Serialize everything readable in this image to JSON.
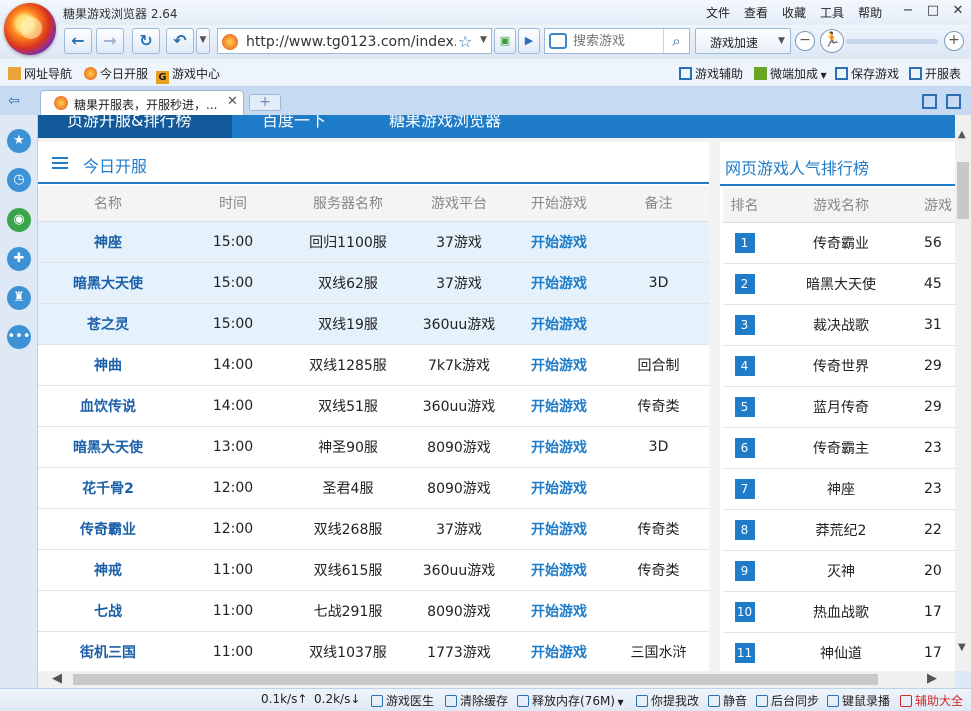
{
  "app": {
    "title": "糖果游戏浏览器 2.64",
    "menu": [
      "文件",
      "查看",
      "收藏",
      "工具",
      "帮助"
    ]
  },
  "toolbar": {
    "url": "http://www.tg0123.com/index.h",
    "search_placeholder": "搜索游戏",
    "speed_label": "游戏加速"
  },
  "bookmarks": {
    "left": [
      "网址导航",
      "今日开服",
      "游戏中心"
    ],
    "right": [
      "游戏辅助",
      "微端加成",
      "保存游戏",
      "开服表"
    ]
  },
  "tab": {
    "title": "糖果开服表，开服秒进，..."
  },
  "site_nav": [
    "页游开服&排行榜",
    "百度一下",
    "糖果游戏浏览器"
  ],
  "server_panel": {
    "title": "今日开服",
    "columns": [
      "名称",
      "时间",
      "服务器名称",
      "游戏平台",
      "开始游戏",
      "备注"
    ],
    "rows": [
      {
        "name": "神座",
        "time": "15:00",
        "server": "回归1100服",
        "platform": "37游戏",
        "start": "开始游戏",
        "note": "",
        "highlight": true
      },
      {
        "name": "暗黑大天使",
        "time": "15:00",
        "server": "双线62服",
        "platform": "37游戏",
        "start": "开始游戏",
        "note": "3D",
        "highlight": true
      },
      {
        "name": "苍之灵",
        "time": "15:00",
        "server": "双线19服",
        "platform": "360uu游戏",
        "start": "开始游戏",
        "note": "",
        "highlight": true
      },
      {
        "name": "神曲",
        "time": "14:00",
        "server": "双线1285服",
        "platform": "7k7k游戏",
        "start": "开始游戏",
        "note": "回合制",
        "highlight": false
      },
      {
        "name": "血饮传说",
        "time": "14:00",
        "server": "双线51服",
        "platform": "360uu游戏",
        "start": "开始游戏",
        "note": "传奇类",
        "highlight": false
      },
      {
        "name": "暗黑大天使",
        "time": "13:00",
        "server": "神圣90服",
        "platform": "8090游戏",
        "start": "开始游戏",
        "note": "3D",
        "highlight": false
      },
      {
        "name": "花千骨2",
        "time": "12:00",
        "server": "圣君4服",
        "platform": "8090游戏",
        "start": "开始游戏",
        "note": "",
        "highlight": false
      },
      {
        "name": "传奇霸业",
        "time": "12:00",
        "server": "双线268服",
        "platform": "37游戏",
        "start": "开始游戏",
        "note": "传奇类",
        "highlight": false
      },
      {
        "name": "神戒",
        "time": "11:00",
        "server": "双线615服",
        "platform": "360uu游戏",
        "start": "开始游戏",
        "note": "传奇类",
        "highlight": false
      },
      {
        "name": "七战",
        "time": "11:00",
        "server": "七战291服",
        "platform": "8090游戏",
        "start": "开始游戏",
        "note": "",
        "highlight": false
      },
      {
        "name": "街机三国",
        "time": "11:00",
        "server": "双线1037服",
        "platform": "1773游戏",
        "start": "开始游戏",
        "note": "三国水浒",
        "highlight": false
      }
    ]
  },
  "rank_panel": {
    "title": "网页游戏人气排行榜",
    "columns": [
      "排名",
      "游戏名称",
      "游戏"
    ],
    "rows": [
      {
        "rank": "1",
        "name": "传奇霸业",
        "count": "56"
      },
      {
        "rank": "2",
        "name": "暗黑大天使",
        "count": "45"
      },
      {
        "rank": "3",
        "name": "裁决战歌",
        "count": "31"
      },
      {
        "rank": "4",
        "name": "传奇世界",
        "count": "29"
      },
      {
        "rank": "5",
        "name": "蓝月传奇",
        "count": "29"
      },
      {
        "rank": "6",
        "name": "传奇霸主",
        "count": "23"
      },
      {
        "rank": "7",
        "name": "神座",
        "count": "23"
      },
      {
        "rank": "8",
        "name": "莽荒纪2",
        "count": "22"
      },
      {
        "rank": "9",
        "name": "灭神",
        "count": "20"
      },
      {
        "rank": "10",
        "name": "热血战歌",
        "count": "17"
      },
      {
        "rank": "11",
        "name": "神仙道",
        "count": "17"
      }
    ]
  },
  "statusbar": {
    "down_speed": "0.1k/s↑",
    "up_speed": "0.2k/s↓",
    "items": [
      "游戏医生",
      "清除缓存",
      "释放内存(76M)",
      "你提我改",
      "静音",
      "后台同步",
      "键鼠录播"
    ],
    "red_item": "辅助大全"
  },
  "colors": {
    "accent": "#1e7cc9",
    "highlight_row": "#e5f2fb",
    "red": "#d12a2a"
  }
}
